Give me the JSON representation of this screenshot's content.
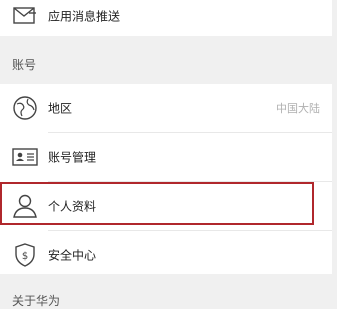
{
  "top_item": {
    "label": "应用消息推送",
    "icon": "mail-icon"
  },
  "account_section": {
    "title": "账号",
    "items": [
      {
        "label": "地区",
        "value": "中国大陆",
        "icon": "globe-icon"
      },
      {
        "label": "账号管理",
        "icon": "id-card-icon"
      },
      {
        "label": "个人资料",
        "icon": "user-icon"
      },
      {
        "label": "安全中心",
        "icon": "shield-icon"
      }
    ]
  },
  "next_section": {
    "title": "关于华为"
  },
  "colors": {
    "background": "#f0f0f0",
    "card": "#ffffff",
    "highlight_border": "#b0272c",
    "secondary_text": "#b0b0b0"
  }
}
